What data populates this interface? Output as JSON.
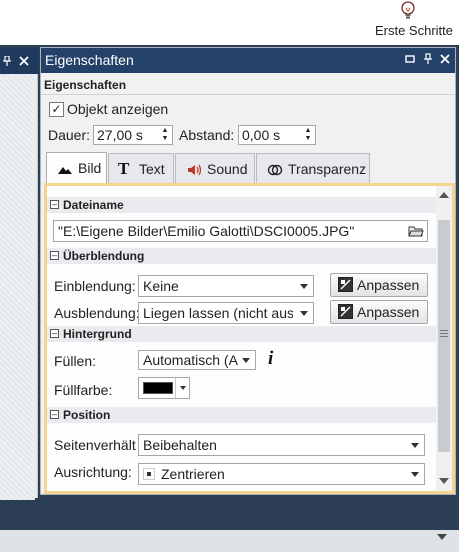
{
  "ribbon": {
    "label": "Erste Schritte",
    "icon": "lightbulb-icon"
  },
  "panel": {
    "title": "Eigenschaften",
    "subtitle": "Eigenschaften",
    "header_icons": [
      "dropdown-icon",
      "pin-icon",
      "close-icon"
    ],
    "show_object": {
      "label": "Objekt anzeigen",
      "checked": true
    },
    "duration": {
      "label": "Dauer:",
      "value": "27,00 s"
    },
    "spacing": {
      "label": "Abstand:",
      "value": "0,00 s"
    }
  },
  "tabs": [
    {
      "label": "Bild",
      "icon": "image-icon",
      "active": true
    },
    {
      "label": "Text",
      "icon": "text-icon",
      "active": false
    },
    {
      "label": "Sound",
      "icon": "speaker-icon",
      "active": false
    },
    {
      "label": "Transparenz",
      "icon": "transparency-icon",
      "active": false
    }
  ],
  "sections": {
    "filename": {
      "title": "Dateiname",
      "value": "\"E:\\Eigene Bilder\\Emilio Galotti\\DSCI0005.JPG\""
    },
    "blending": {
      "title": "Überblendung",
      "fade_in": {
        "label": "Einblendung:",
        "value": "Keine",
        "button": "Anpassen"
      },
      "fade_out": {
        "label": "Ausblendung:",
        "value": "Liegen lassen (nicht ausb",
        "button": "Anpassen"
      }
    },
    "background": {
      "title": "Hintergrund",
      "fill": {
        "label": "Füllen:",
        "value": "Automatisch (A"
      },
      "fill_color": {
        "label": "Füllfarbe:",
        "color": "#000000"
      }
    },
    "position": {
      "title": "Position",
      "aspect": {
        "label": "Seitenverhält",
        "value": "Beibehalten"
      },
      "alignment": {
        "label": "Ausrichtung:",
        "value": "Zentrieren"
      }
    }
  },
  "colors": {
    "panel_header": "#24416a",
    "accent_border": "#f4d48e",
    "background": "#2c3e55"
  }
}
